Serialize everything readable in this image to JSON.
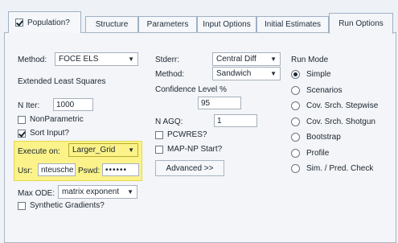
{
  "tabs": {
    "population": "Population?",
    "structure": "Structure",
    "parameters": "Parameters",
    "input_options": "Input Options",
    "initial_estimates": "Initial Estimates",
    "run_options": "Run Options"
  },
  "left": {
    "method_label": "Method:",
    "method_value": "FOCE ELS",
    "method_desc": "Extended Least Squares",
    "niter_label": "N Iter:",
    "niter_value": "1000",
    "nonparametric": "NonParametric",
    "sort_input": "Sort Input?",
    "execute_label": "Execute on:",
    "execute_value": "Larger_Grid",
    "usr_label": "Usr:",
    "usr_value": "nteusche",
    "pswd_label": "Pswd:",
    "pswd_value": "••••••",
    "maxode_label": "Max ODE:",
    "maxode_value": "matrix exponent",
    "synthetic": "Synthetic Gradients?"
  },
  "middle": {
    "stderr_label": "Stderr:",
    "stderr_value": "Central Diff",
    "method_label": "Method:",
    "method_value": "Sandwich",
    "conf_label": "Confidence Level %",
    "conf_value": "95",
    "nagq_label": "N AGQ:",
    "nagq_value": "1",
    "pcwres": "PCWRES?",
    "mapnp": "MAP-NP Start?",
    "advanced": "Advanced >>"
  },
  "runmode": {
    "title": "Run Mode",
    "options": [
      "Simple",
      "Scenarios",
      "Cov. Srch. Stepwise",
      "Cov. Srch. Shotgun",
      "Bootstrap",
      "Profile",
      "Sim. / Pred. Check"
    ],
    "selected": "Simple"
  },
  "state": {
    "population_checked": true,
    "nonparametric_checked": false,
    "sort_input_checked": true,
    "synthetic_checked": false,
    "pcwres_checked": false,
    "mapnp_checked": false
  }
}
